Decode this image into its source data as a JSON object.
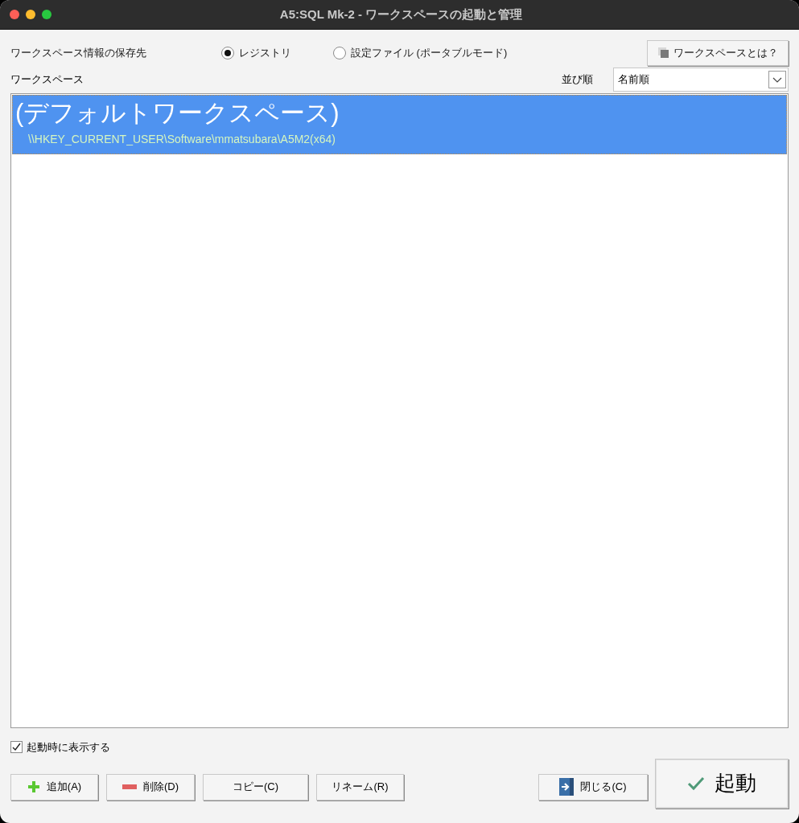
{
  "window": {
    "title": "A5:SQL Mk-2 - ワークスペースの起動と管理"
  },
  "storage": {
    "label": "ワークスペース情報の保存先",
    "options": [
      {
        "label": "レジストリ",
        "selected": true
      },
      {
        "label": "設定ファイル (ポータブルモード)",
        "selected": false
      }
    ],
    "help_button": "ワークスペースとは？"
  },
  "list_label": "ワークスペース",
  "sort": {
    "label": "並び順",
    "value": "名前順"
  },
  "workspaces": [
    {
      "name": "(デフォルトワークスペース)",
      "path": "\\\\HKEY_CURRENT_USER\\Software\\mmatsubara\\A5M2(x64)",
      "selected": true
    }
  ],
  "show_on_startup": {
    "label": "起動時に表示する",
    "checked": true
  },
  "buttons": [
    {
      "label": "追加(A)",
      "kind": "add"
    },
    {
      "label": "削除(D)",
      "kind": "remove"
    },
    {
      "label": "コピー(C)",
      "kind": "plain"
    },
    {
      "label": "リネーム(R)",
      "kind": "plain"
    }
  ],
  "close_button": "閉じる(C)",
  "launch_button": "起動"
}
